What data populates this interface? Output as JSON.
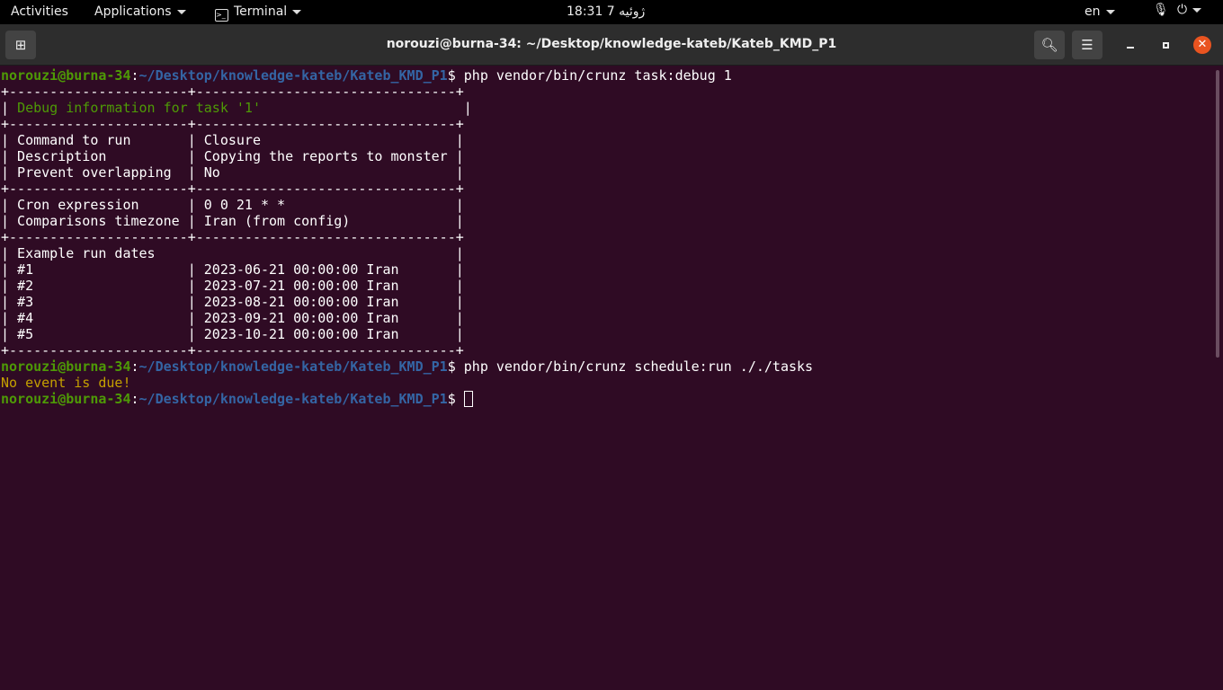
{
  "topbar": {
    "activities": "Activities",
    "applications": "Applications",
    "app": "Terminal",
    "clock": "18:31 7 ژوئیه",
    "lang": "en"
  },
  "window": {
    "title": "norouzi@burna-34: ~/Desktop/knowledge-kateb/Kateb_KMD_P1"
  },
  "terminal": {
    "lines": [
      [
        [
          "g",
          "norouzi@burna-34"
        ],
        [
          "w",
          ":"
        ],
        [
          "b",
          "~/Desktop/knowledge-kateb/Kateb_KMD_P1"
        ],
        [
          "w",
          "$ php vendor/bin/crunz task:debug 1"
        ]
      ],
      [
        [
          "w",
          "+----------------------+--------------------------------+"
        ]
      ],
      [
        [
          "w",
          "| "
        ],
        [
          "gr",
          "Debug information for task '1'"
        ],
        [
          "w",
          "                         |"
        ]
      ],
      [
        [
          "w",
          "+----------------------+--------------------------------+"
        ]
      ],
      [
        [
          "w",
          "| Command to run       | Closure                        |"
        ]
      ],
      [
        [
          "w",
          "| Description          | Copying the reports to monster |"
        ]
      ],
      [
        [
          "w",
          "| Prevent overlapping  | No                             |"
        ]
      ],
      [
        [
          "w",
          "+----------------------+--------------------------------+"
        ]
      ],
      [
        [
          "w",
          "| Cron expression      | 0 0 21 * *                     |"
        ]
      ],
      [
        [
          "w",
          "| Comparisons timezone | Iran (from config)             |"
        ]
      ],
      [
        [
          "w",
          "+----------------------+--------------------------------+"
        ]
      ],
      [
        [
          "w",
          "| Example run dates                                     |"
        ]
      ],
      [
        [
          "w",
          "| #1                   | 2023-06-21 00:00:00 Iran       |"
        ]
      ],
      [
        [
          "w",
          "| #2                   | 2023-07-21 00:00:00 Iran       |"
        ]
      ],
      [
        [
          "w",
          "| #3                   | 2023-08-21 00:00:00 Iran       |"
        ]
      ],
      [
        [
          "w",
          "| #4                   | 2023-09-21 00:00:00 Iran       |"
        ]
      ],
      [
        [
          "w",
          "| #5                   | 2023-10-21 00:00:00 Iran       |"
        ]
      ],
      [
        [
          "w",
          "+----------------------+--------------------------------+"
        ]
      ],
      [
        [
          "g",
          "norouzi@burna-34"
        ],
        [
          "w",
          ":"
        ],
        [
          "b",
          "~/Desktop/knowledge-kateb/Kateb_KMD_P1"
        ],
        [
          "w",
          "$ php vendor/bin/crunz schedule:run ././tasks"
        ]
      ],
      [
        [
          "y",
          "No event is due!"
        ]
      ],
      [
        [
          "g",
          "norouzi@burna-34"
        ],
        [
          "w",
          ":"
        ],
        [
          "b",
          "~/Desktop/knowledge-kateb/Kateb_KMD_P1"
        ],
        [
          "w",
          "$ "
        ]
      ]
    ]
  }
}
